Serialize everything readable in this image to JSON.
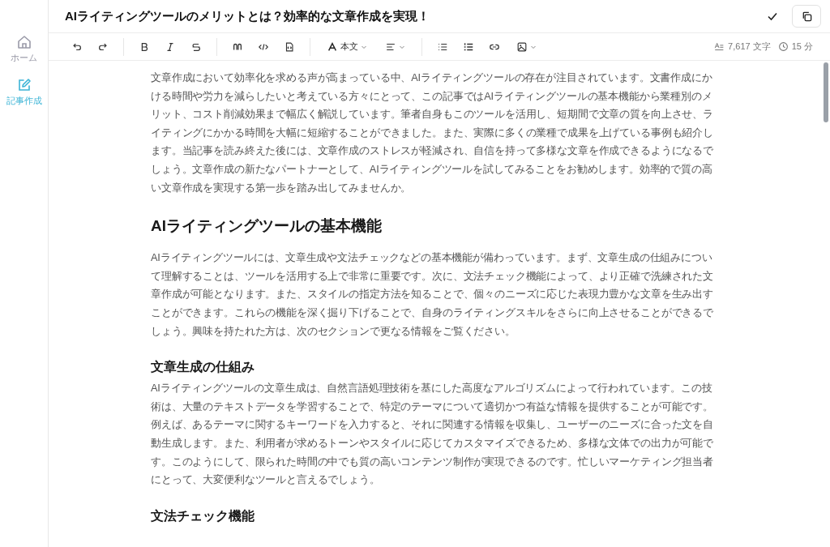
{
  "sidebar": {
    "items": [
      {
        "label": "ホーム",
        "kind": "home",
        "selected": false
      },
      {
        "label": "記事作成",
        "kind": "edit",
        "selected": true
      }
    ]
  },
  "title": "AIライティングツールのメリットとは？効率的な文章作成を実現！",
  "toolbar": {
    "text_style": "本文"
  },
  "stats": {
    "characters": "7,617 文字",
    "reading_time": "15 分"
  },
  "document": [
    {
      "kind": "paragraph",
      "text": "文章作成において効率化を求める声が高まっている中、AIライティングツールの存在が注目されています。文書作成にかける時間や労力を減らしたいと考えている方々にとって、この記事ではAIライティングツールの基本機能から業種別のメリット、コスト削減効果まで幅広く解説しています。筆者自身もこのツールを活用し、短期間で文章の質を向上させ、ライティングにかかる時間を大幅に短縮することができました。また、実際に多くの業種で成果を上げている事例も紹介します。当記事を読み終えた後には、文章作成のストレスが軽減され、自信を持って多様な文章を作成できるようになるでしょう。文章作成の新たなパートナーとして、AIライティングツールを試してみることをお勧めします。効率的で質の高い文章作成を実現する第一歩を踏み出してみませんか。"
    },
    {
      "kind": "h2",
      "text": "AIライティングツールの基本機能"
    },
    {
      "kind": "paragraph",
      "text": "AIライティングツールには、文章生成や文法チェックなどの基本機能が備わっています。まず、文章生成の仕組みについて理解することは、ツールを活用する上で非常に重要です。次に、文法チェック機能によって、より正確で洗練された文章作成が可能となります。また、スタイルの指定方法を知ることで、個々のニーズに応じた表現力豊かな文章を生み出すことができます。これらの機能を深く掘り下げることで、自身のライティングスキルをさらに向上させることができるでしょう。興味を持たれた方は、次のセクションで更なる情報をご覧ください。"
    },
    {
      "kind": "h3",
      "text": "文章生成の仕組み"
    },
    {
      "kind": "paragraph",
      "text": "AIライティングツールの文章生成は、自然言語処理技術を基にした高度なアルゴリズムによって行われています。この技術は、大量のテキストデータを学習することで、特定のテーマについて適切かつ有益な情報を提供することが可能です。例えば、あるテーマに関するキーワードを入力すると、それに関連する情報を収集し、ユーザーのニーズに合った文を自動生成します。また、利用者が求めるトーンやスタイルに応じてカスタマイズできるため、多様な文体での出力が可能です。このようにして、限られた時間の中でも質の高いコンテンツ制作が実現できるのです。忙しいマーケティング担当者にとって、大変便利なツールと言えるでしょう。"
    },
    {
      "kind": "h3",
      "text": "文法チェック機能"
    }
  ]
}
